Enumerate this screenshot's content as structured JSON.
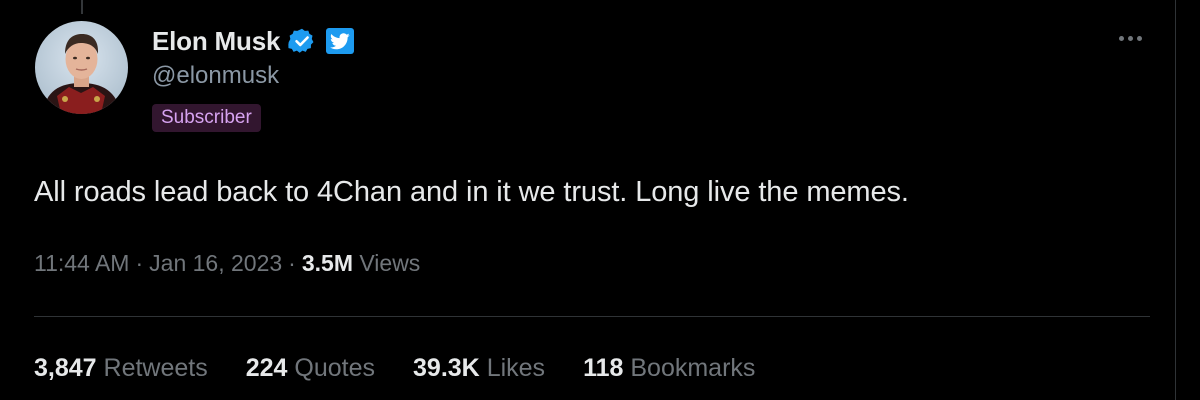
{
  "author": {
    "display_name": "Elon Musk",
    "handle": "@elonmusk",
    "badge": "Subscriber",
    "avatar_icon": "profile-photo",
    "verified_icon": "verified-check-icon",
    "platform_icon": "twitter-bird-icon"
  },
  "tweet": {
    "text": "All roads lead back to 4Chan and in it we trust. Long live the memes.",
    "time": "11:44 AM",
    "date": "Jan 16, 2023",
    "meta_separator": "·",
    "views_count": "3.5M",
    "views_label": "Views"
  },
  "stats": {
    "retweets": {
      "count": "3,847",
      "label": "Retweets"
    },
    "quotes": {
      "count": "224",
      "label": "Quotes"
    },
    "likes": {
      "count": "39.3K",
      "label": "Likes"
    },
    "bookmarks": {
      "count": "118",
      "label": "Bookmarks"
    }
  },
  "colors": {
    "background": "#000000",
    "primary_text": "#e7e9ea",
    "secondary_text": "#71767b",
    "accent_blue": "#1d9bf0",
    "subscriber_bg": "#32162f",
    "subscriber_text": "#d6a3f0"
  },
  "more_icon": "more-horizontal-icon"
}
